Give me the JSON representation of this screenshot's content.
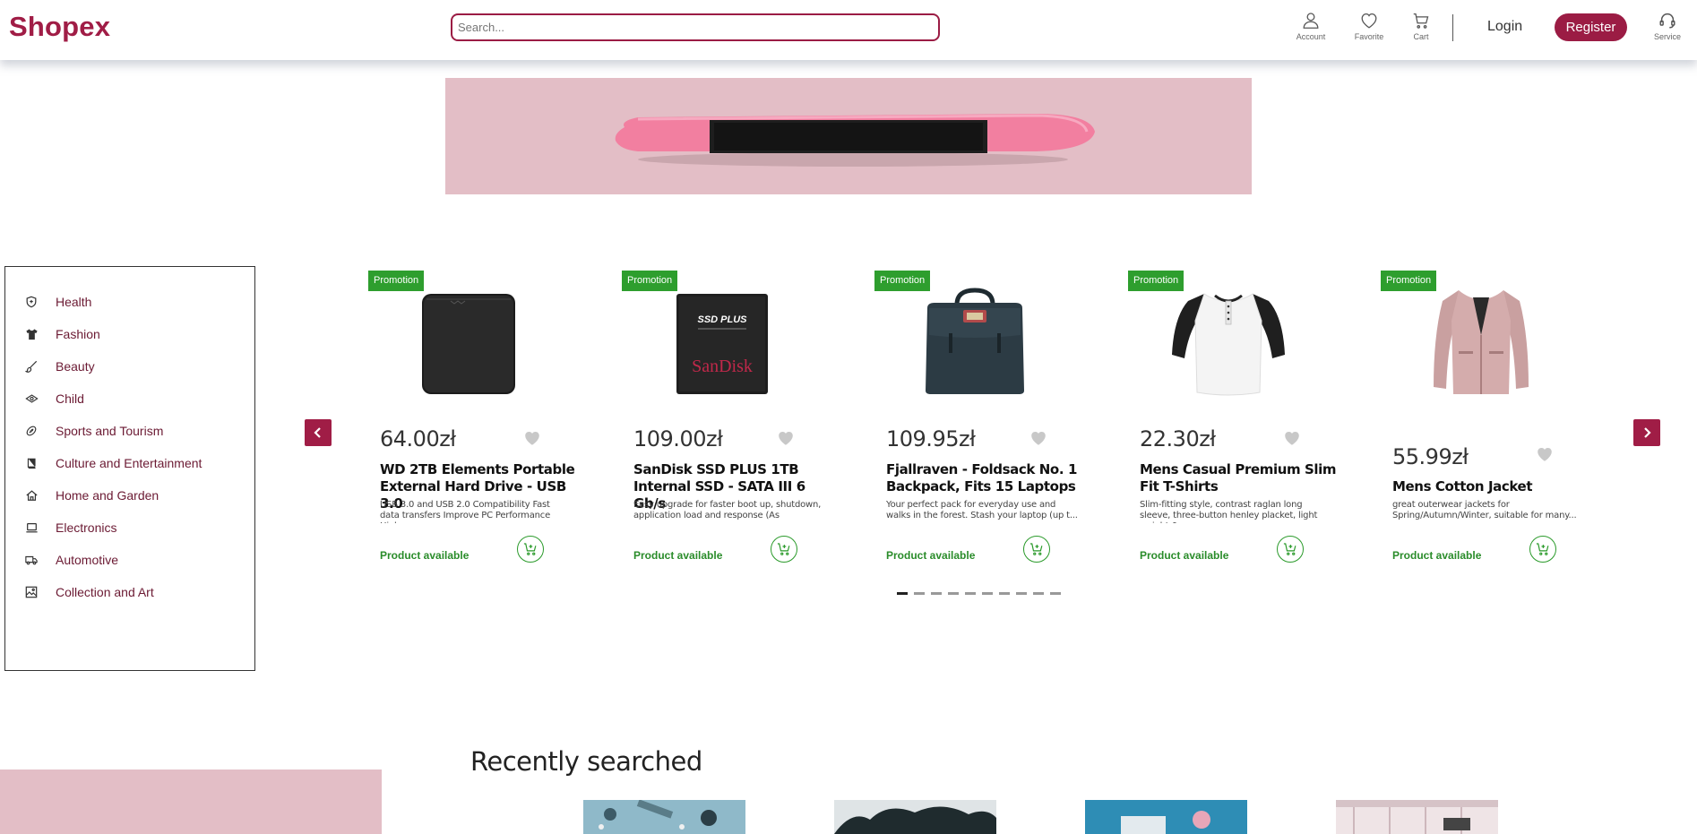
{
  "header": {
    "logo": "Shopex",
    "search_placeholder": "Search...",
    "icons": [
      {
        "icon": "account-icon",
        "label": "Account"
      },
      {
        "icon": "heart-icon",
        "label": "Favorite"
      },
      {
        "icon": "cart-icon",
        "label": "Cart"
      },
      {
        "icon": "headset-icon",
        "label": "Service"
      }
    ],
    "login_label": "Login",
    "register_label": "Register"
  },
  "categories": [
    {
      "icon": "shield-icon",
      "label": "Health"
    },
    {
      "icon": "tshirt-icon",
      "label": "Fashion"
    },
    {
      "icon": "brush-icon",
      "label": "Beauty"
    },
    {
      "icon": "child-icon",
      "label": "Child"
    },
    {
      "icon": "ball-icon",
      "label": "Sports and Tourism"
    },
    {
      "icon": "book-icon",
      "label": "Culture and Entertainment"
    },
    {
      "icon": "house-icon",
      "label": "Home and Garden"
    },
    {
      "icon": "laptop-icon",
      "label": "Electronics"
    },
    {
      "icon": "truck-icon",
      "label": "Automotive"
    },
    {
      "icon": "picture-icon",
      "label": "Collection and Art"
    }
  ],
  "products": [
    {
      "badge": "Promotion",
      "price": "64.00zł",
      "title": "WD 2TB Elements Portable External Hard Drive - USB 3.0",
      "desc": "USB 3.0 and USB 2.0 Compatibility Fast data transfers Improve PC Performance High...",
      "availability": "Product available",
      "image": "hard-drive"
    },
    {
      "badge": "Promotion",
      "price": "109.00zł",
      "title": "SanDisk SSD PLUS 1TB Internal SSD - SATA III 6 Gb/s",
      "desc": "Easy upgrade for faster boot up, shutdown, application load and response (As compare...",
      "availability": "Product available",
      "image": "ssd"
    },
    {
      "badge": "Promotion",
      "price": "109.95zł",
      "title": "Fjallraven - Foldsack No. 1 Backpack, Fits 15 Laptops",
      "desc": "Your perfect pack for everyday use and walks in the forest. Stash your laptop (up t...",
      "availability": "Product available",
      "image": "backpack"
    },
    {
      "badge": "Promotion",
      "price": "22.30zł",
      "title": "Mens Casual Premium Slim Fit T-Shirts",
      "desc": "Slim-fitting style, contrast raglan long sleeve, three-button henley placket, light weight &...",
      "availability": "Product available",
      "image": "tshirt"
    },
    {
      "badge": "Promotion",
      "price": "55.99zł",
      "title": "Mens Cotton Jacket",
      "desc": "great outerwear jackets for Spring/Autumn/Winter, suitable for many...",
      "availability": "Product available",
      "image": "jacket"
    }
  ],
  "ssd_image_text": {
    "line1": "SSD PLUS",
    "brand": "SanDisk"
  },
  "carousel": {
    "pages": 10,
    "active_page": 1
  },
  "recent": {
    "title": "Recently searched"
  },
  "colors": {
    "brand": "#9b1c44",
    "promo": "#2e9e2e",
    "available": "#2a8c2a",
    "banner": "#e3bec6"
  }
}
